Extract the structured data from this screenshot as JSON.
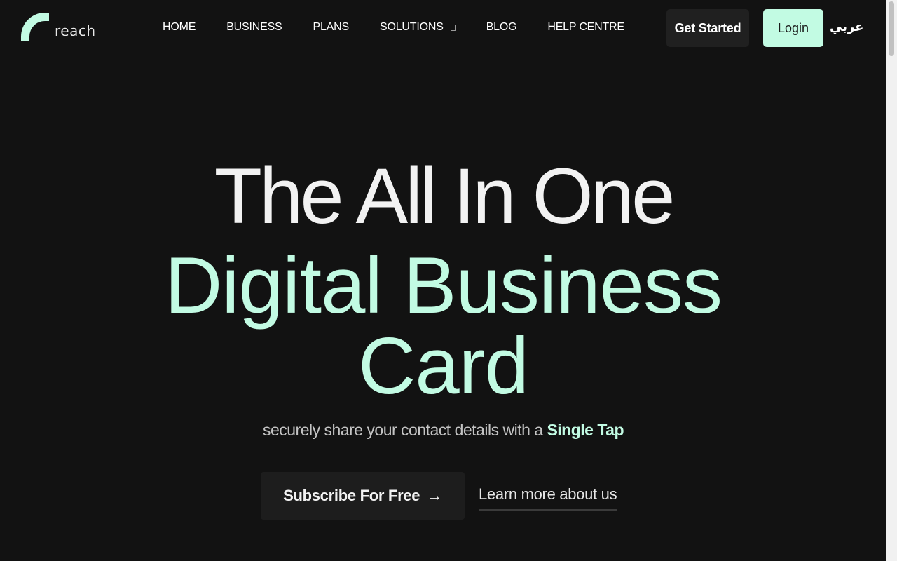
{
  "header": {
    "logo_text": "reach",
    "nav": [
      {
        "label": "HOME"
      },
      {
        "label": "BUSINESS"
      },
      {
        "label": "PLANS"
      },
      {
        "label": "SOLUTIONS"
      },
      {
        "label": "BLOG"
      },
      {
        "label": "HELP CENTRE"
      }
    ],
    "get_started_label": "Get Started",
    "login_label": "Login",
    "language_label": "عربي"
  },
  "hero": {
    "line1": "The All In One",
    "line2": "Digital Business",
    "line3": "Card",
    "subtitle_prefix": "securely share your contact details with a ",
    "subtitle_highlight": "Single Tap",
    "subscribe_label": "Subscribe For Free",
    "subscribe_arrow": "→",
    "learn_more_label": "Learn more about us"
  },
  "colors": {
    "background": "#121212",
    "accent": "#c2fbe3",
    "button_dark": "#202020"
  }
}
